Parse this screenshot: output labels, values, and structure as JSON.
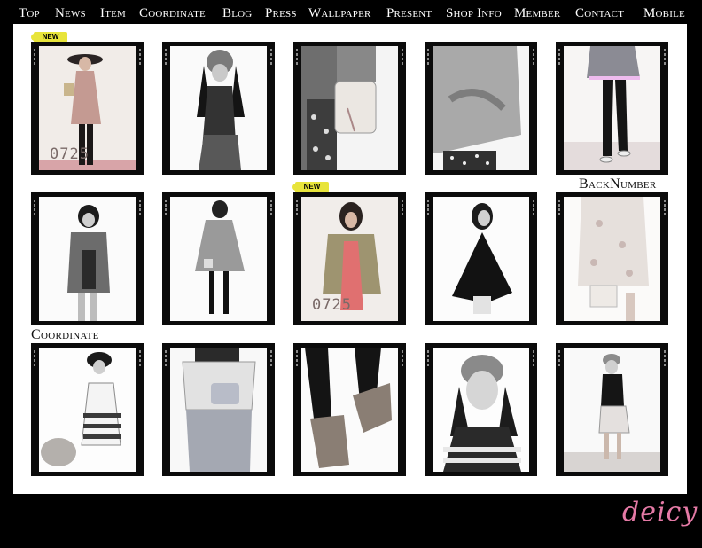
{
  "nav": {
    "items": [
      "Top",
      "News",
      "Item",
      "Coordinate",
      "Blog",
      "Press",
      "Wallpaper",
      "Present",
      "Shop Info",
      "Member",
      "Contact",
      "Mobile"
    ]
  },
  "badges": {
    "new_label": "NEW"
  },
  "sections": {
    "backnumber": "BackNumber",
    "coordinate": "Coordinate"
  },
  "stamps": {
    "date_1": "0725",
    "date_2": "0725"
  },
  "logo": {
    "text": "deicy"
  },
  "colors": {
    "background": "#000000",
    "panel": "#ffffff",
    "badge": "#e8e43a",
    "logo": "#e57aa6"
  }
}
